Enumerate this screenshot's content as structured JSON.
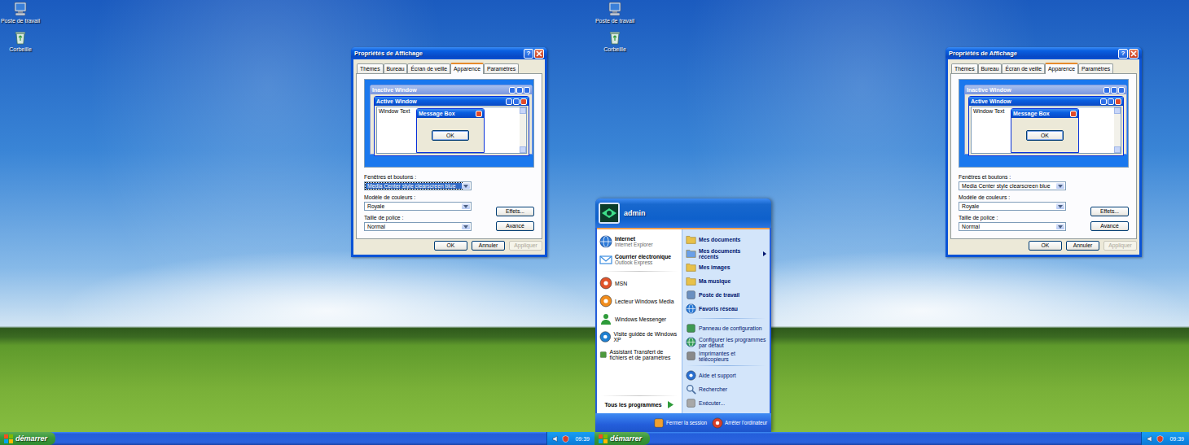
{
  "screens": [
    {
      "start_menu_open": false,
      "desktop_icons": [
        {
          "label": "Poste de travail",
          "kind": "computer"
        },
        {
          "label": "Corbeille",
          "kind": "recycle-bin"
        }
      ],
      "dialog": {
        "title": "Propriétés de Affichage",
        "help_button": "?",
        "tabs": [
          {
            "label": "Thèmes",
            "selected": false
          },
          {
            "label": "Bureau",
            "selected": false
          },
          {
            "label": "Écran de veille",
            "selected": false
          },
          {
            "label": "Apparence",
            "selected": true
          },
          {
            "label": "Paramètres",
            "selected": false
          }
        ],
        "preview": {
          "inactive_title": "Inactive Window",
          "active_title": "Active Window",
          "window_text": "Window Text",
          "message_title": "Message Box",
          "message_button": "OK"
        },
        "fields": [
          {
            "label": "Fenêtres et boutons :",
            "value": "Media Center style clearscreen blue",
            "focused": true
          },
          {
            "label": "Modèle de couleurs :",
            "value": "Royale",
            "focused": false
          },
          {
            "label": "Taille de police :",
            "value": "Normal",
            "focused": false
          }
        ],
        "side_buttons": [
          "Effets...",
          "Avancé"
        ],
        "buttons": [
          {
            "label": "OK",
            "disabled": false
          },
          {
            "label": "Annuler",
            "disabled": false
          },
          {
            "label": "Appliquer",
            "disabled": true
          }
        ]
      },
      "taskbar": {
        "start_label": "démarrer",
        "clock": "09:39"
      }
    },
    {
      "start_menu_open": true,
      "desktop_icons": [
        {
          "label": "Poste de travail",
          "kind": "computer"
        },
        {
          "label": "Corbeille",
          "kind": "recycle-bin"
        }
      ],
      "dialog": {
        "title": "Propriétés de Affichage",
        "help_button": "?",
        "tabs": [
          {
            "label": "Thèmes",
            "selected": false
          },
          {
            "label": "Bureau",
            "selected": false
          },
          {
            "label": "Écran de veille",
            "selected": false
          },
          {
            "label": "Apparence",
            "selected": true
          },
          {
            "label": "Paramètres",
            "selected": false
          }
        ],
        "preview": {
          "inactive_title": "Inactive Window",
          "active_title": "Active Window",
          "window_text": "Window Text",
          "message_title": "Message Box",
          "message_button": "OK"
        },
        "fields": [
          {
            "label": "Fenêtres et boutons :",
            "value": "Media Center style clearscreen blue",
            "focused": false
          },
          {
            "label": "Modèle de couleurs :",
            "value": "Royale",
            "focused": false
          },
          {
            "label": "Taille de police :",
            "value": "Normal",
            "focused": false
          }
        ],
        "side_buttons": [
          "Effets...",
          "Avancé"
        ],
        "buttons": [
          {
            "label": "OK",
            "disabled": false
          },
          {
            "label": "Annuler",
            "disabled": false
          },
          {
            "label": "Appliquer",
            "disabled": true
          }
        ]
      },
      "taskbar": {
        "start_label": "démarrer",
        "clock": "09:39"
      }
    }
  ],
  "start_menu": {
    "user": "admin",
    "pinned": [
      {
        "title": "Internet",
        "subtitle": "Internet Explorer",
        "kind": "browser"
      },
      {
        "title": "Courrier électronique",
        "subtitle": "Outlook Express",
        "kind": "mail"
      }
    ],
    "recent": [
      {
        "label": "MSN",
        "kind": "msn"
      },
      {
        "label": "Lecteur Windows Media",
        "kind": "media"
      },
      {
        "label": "Windows Messenger",
        "kind": "messenger"
      },
      {
        "label": "Visite guidée de Windows XP",
        "kind": "tour"
      },
      {
        "label": "Assistant Transfert de fichiers et de paramètres",
        "kind": "transfer"
      }
    ],
    "all_programs": "Tous les programmes",
    "places": [
      [
        {
          "label": "Mes documents",
          "kind": "folder",
          "emphasized": true,
          "submenu": false
        },
        {
          "label": "Mes documents récents",
          "kind": "recent",
          "emphasized": true,
          "submenu": true
        },
        {
          "label": "Mes images",
          "kind": "pictures",
          "emphasized": true,
          "submenu": false
        },
        {
          "label": "Ma musique",
          "kind": "music",
          "emphasized": true,
          "submenu": false
        },
        {
          "label": "Poste de travail",
          "kind": "computer",
          "emphasized": true,
          "submenu": false
        },
        {
          "label": "Favoris réseau",
          "kind": "network",
          "emphasized": true,
          "submenu": false
        }
      ],
      [
        {
          "label": "Panneau de configuration",
          "kind": "control",
          "emphasized": false,
          "submenu": false
        },
        {
          "label": "Configurer les programmes par défaut",
          "kind": "defaults",
          "emphasized": false,
          "submenu": false
        },
        {
          "label": "Imprimantes et télécopieurs",
          "kind": "printers",
          "emphasized": false,
          "submenu": false
        }
      ],
      [
        {
          "label": "Aide et support",
          "kind": "help",
          "emphasized": false,
          "submenu": false
        },
        {
          "label": "Rechercher",
          "kind": "search",
          "emphasized": false,
          "submenu": false
        },
        {
          "label": "Exécuter...",
          "kind": "run",
          "emphasized": false,
          "submenu": false
        }
      ]
    ],
    "footer": [
      {
        "label": "Fermer la session",
        "kind": "logoff"
      },
      {
        "label": "Arrêter l'ordinateur",
        "kind": "shutdown"
      }
    ]
  }
}
